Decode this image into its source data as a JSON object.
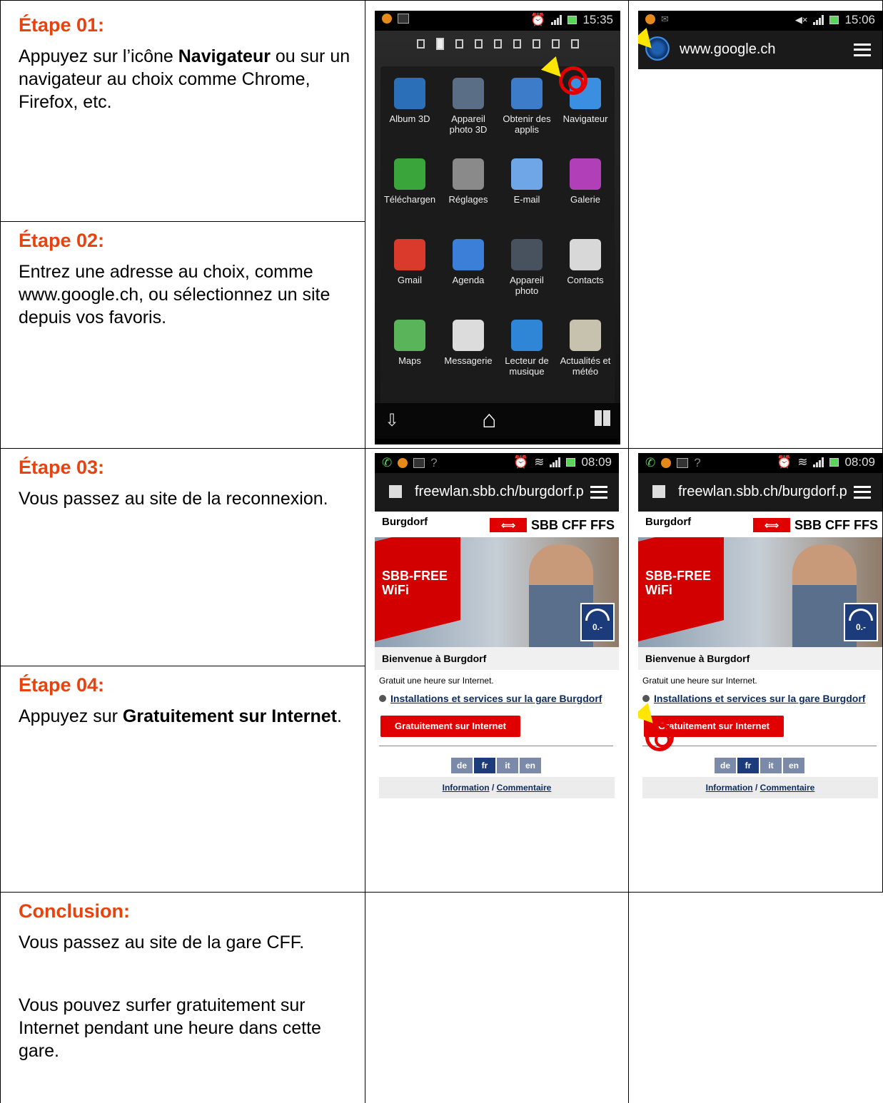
{
  "steps": [
    {
      "title": "Étape 01:",
      "text_before": "Appuyez sur l’icône ",
      "bold": "Navigateur",
      "text_after": " ou sur un navigateur au choix comme Chrome, Firefox, etc."
    },
    {
      "title": "Étape 02:",
      "text": "Entrez une adresse au choix, comme www.google.ch, ou sélectionnez un site depuis vos favoris."
    },
    {
      "title": "Étape 03:",
      "text": "Vous passez au site de la reconnexion."
    },
    {
      "title": "Étape 04:",
      "text_before": "Appuyez sur ",
      "bold": "Gratuitement sur Internet",
      "text_after": "."
    }
  ],
  "conclusion": {
    "title": "Conclusion:",
    "para1": "Vous passez au site de la gare CFF.",
    "para2": "Vous pouvez surfer gratuitement sur Internet pendant une heure dans cette gare."
  },
  "phone1": {
    "time": "15:35",
    "apps": [
      {
        "label": "Album 3D",
        "icon": "album-3d-icon",
        "color": "#2b6fb8"
      },
      {
        "label": "Appareil photo 3D",
        "icon": "camera-3d-icon",
        "color": "#5a6e86"
      },
      {
        "label": "Obtenir des applis",
        "icon": "get-apps-icon",
        "color": "#3d7cc9"
      },
      {
        "label": "Navigateur",
        "icon": "browser-icon",
        "color": "#3b8fe0"
      },
      {
        "label": "Téléchargen",
        "icon": "download-icon",
        "color": "#3aa53a"
      },
      {
        "label": "Réglages",
        "icon": "settings-icon",
        "color": "#8a8a8a"
      },
      {
        "label": "E-mail",
        "icon": "email-icon",
        "color": "#6fa6e8"
      },
      {
        "label": "Galerie",
        "icon": "gallery-icon",
        "color": "#b03fb8"
      },
      {
        "label": "Gmail",
        "icon": "gmail-icon",
        "color": "#d93a2b"
      },
      {
        "label": "Agenda",
        "icon": "calendar-icon",
        "color": "#3c7fd8"
      },
      {
        "label": "Appareil photo",
        "icon": "camera-icon",
        "color": "#47525e"
      },
      {
        "label": "Contacts",
        "icon": "contacts-icon",
        "color": "#d8d8d8"
      },
      {
        "label": "Maps",
        "icon": "maps-icon",
        "color": "#5ab55a"
      },
      {
        "label": "Messagerie",
        "icon": "messaging-icon",
        "color": "#dcdcdc"
      },
      {
        "label": "Lecteur de musique",
        "icon": "music-icon",
        "color": "#2f86d6"
      },
      {
        "label": "Actualités et météo",
        "icon": "news-icon",
        "color": "#c7c2ae"
      }
    ]
  },
  "phone2": {
    "time": "15:06",
    "url": "www.google.ch"
  },
  "phone3": {
    "time": "08:09",
    "url": "freewlan.sbb.ch/burgdorf.p",
    "city": "Burgdorf",
    "logo_text": "SBB CFF FFS",
    "hero_line1": "SBB-FREE",
    "hero_line2": "WiFi",
    "wifi_badge": "0.-",
    "welcome": "Bienvenue à Burgdorf",
    "free_text": "Gratuit une heure sur Internet.",
    "installations": "Installations et services sur la gare Burgdorf",
    "button": "Gratuitement sur Internet",
    "langs": [
      "de",
      "fr",
      "it",
      "en"
    ],
    "active_lang": "fr",
    "info": "Information",
    "slash": " / ",
    "comment": "Commentaire"
  }
}
